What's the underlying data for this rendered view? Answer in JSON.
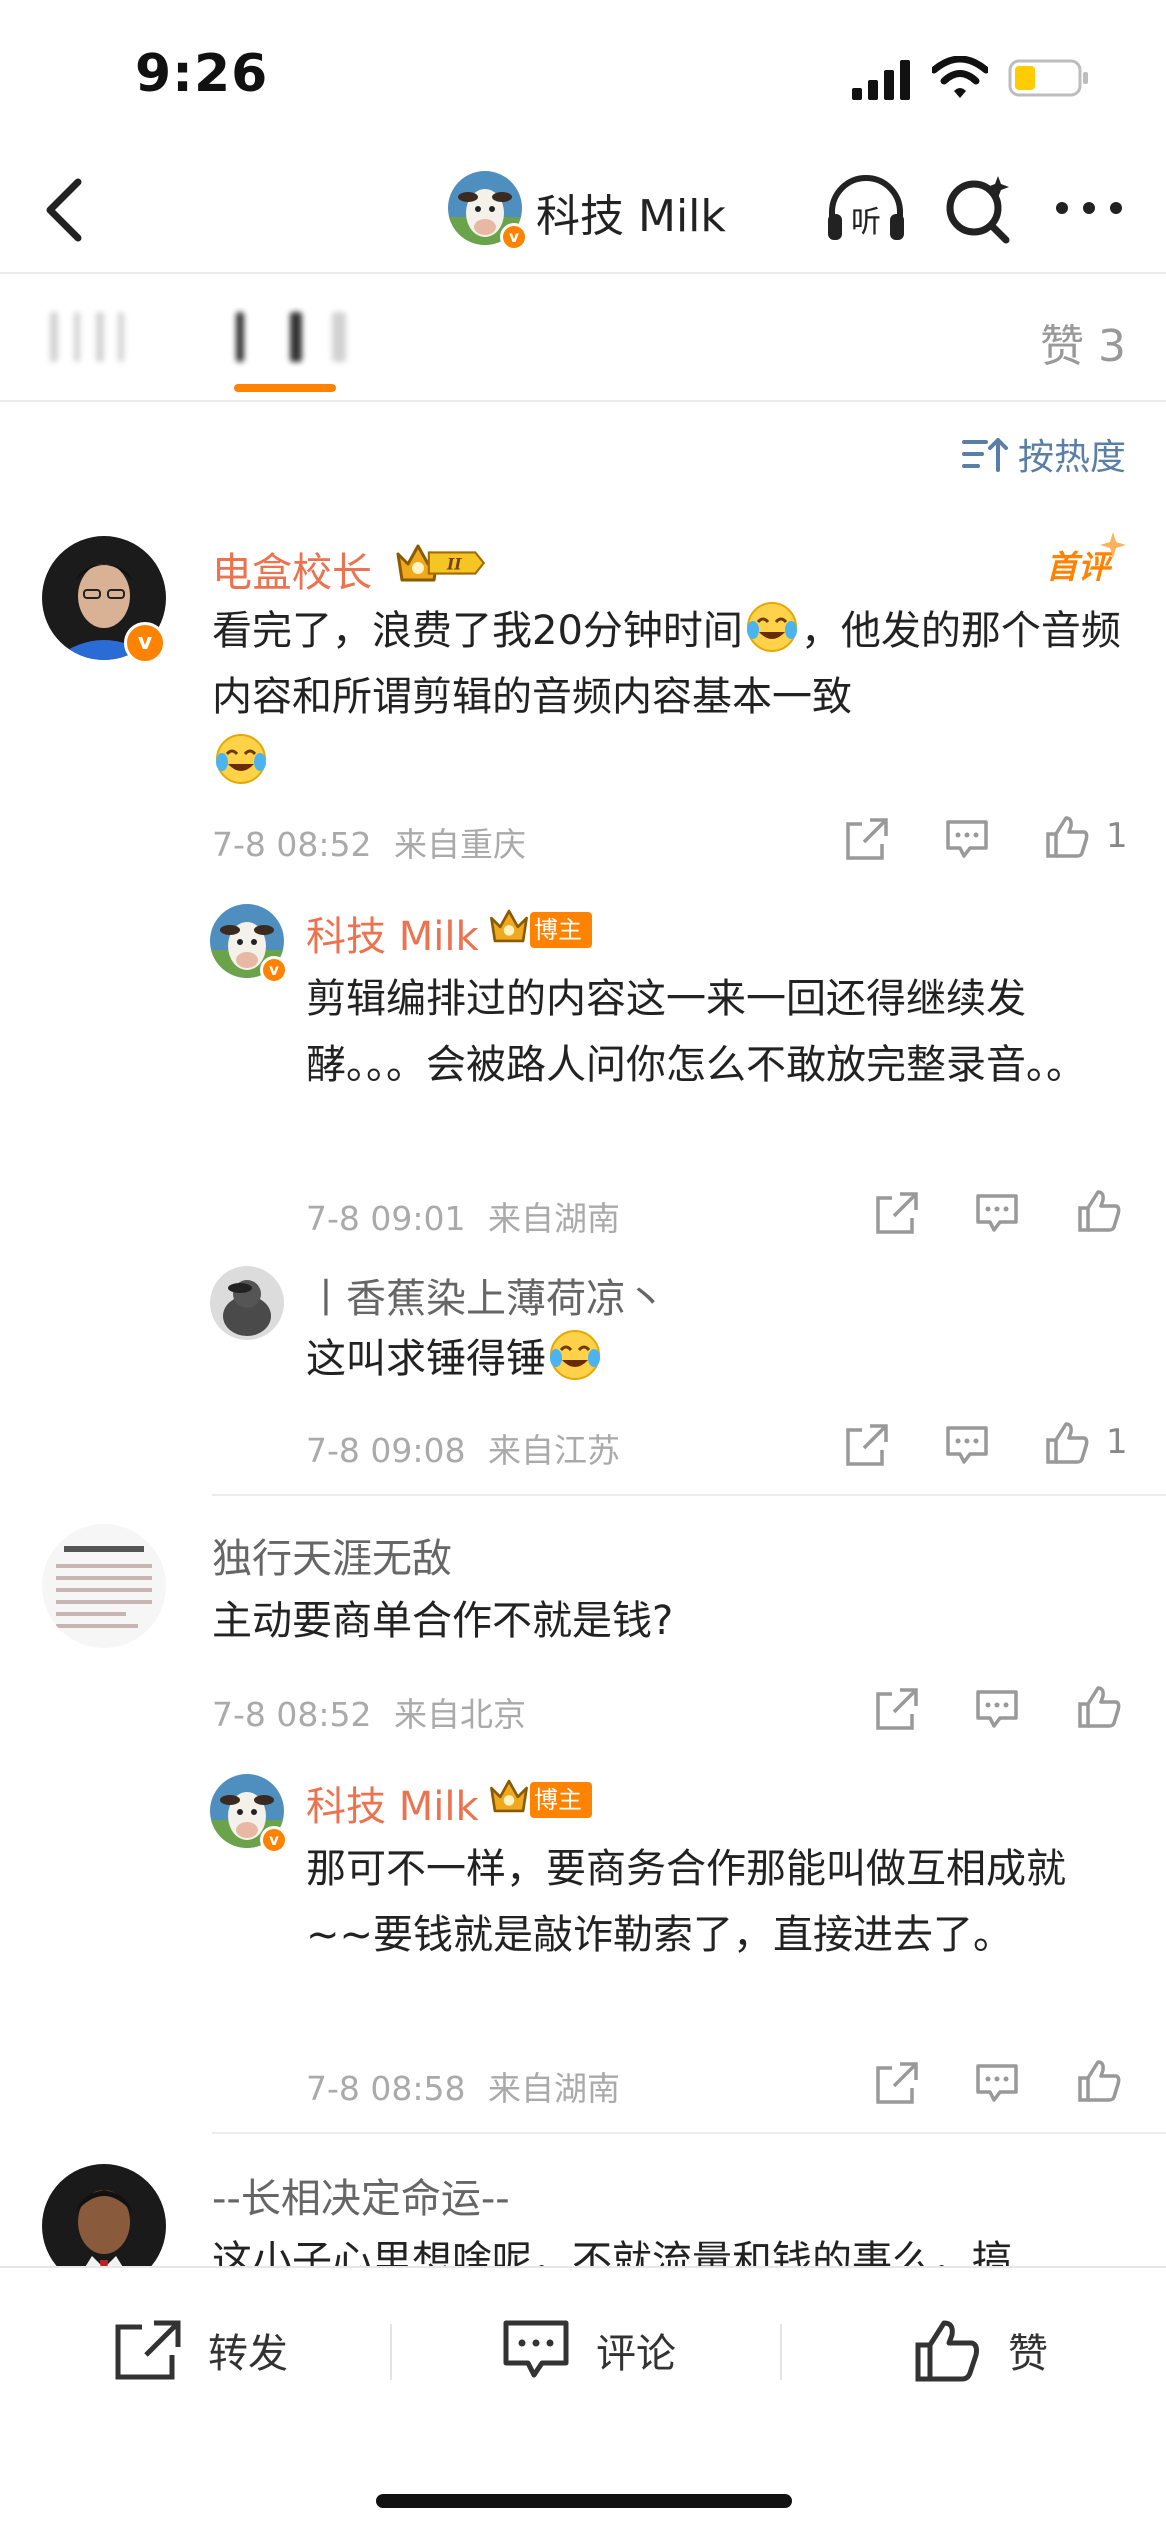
{
  "status_bar": {
    "time": "9:26"
  },
  "nav": {
    "title": "科技 Milk",
    "listen_glyph": "听"
  },
  "tabs": {
    "likes_label": "赞 3"
  },
  "sort": {
    "label": "按热度"
  },
  "comments": [
    {
      "user": "电盒校长",
      "level": "II",
      "first_tag": "首评",
      "text_a": "看完了，浪费了我20分钟时间",
      "text_b": "，他发的那个音频内容和所谓剪辑的音频内容基本一致",
      "time": "7-8 08:52",
      "location": "来自重庆",
      "likes": "1",
      "replies": [
        {
          "user": "科技 Milk",
          "tag": "博主",
          "text": "剪辑编排过的内容这一来一回还得继续发酵。。。会被路人问你怎么不敢放完整录音。。",
          "time": "7-8 09:01",
          "location": "来自湖南"
        },
        {
          "user": "丨香蕉染上薄荷凉丶",
          "text": "这叫求锤得锤",
          "time": "7-8 09:08",
          "location": "来自江苏",
          "likes": "1"
        }
      ]
    },
    {
      "user": "独行天涯无敌",
      "text": "主动要商单合作不就是钱?",
      "time": "7-8 08:52",
      "location": "来自北京",
      "replies": [
        {
          "user": "科技 Milk",
          "tag": "博主",
          "text": "那可不一样，要商务合作那能叫做互相成就 ~~要钱就是敲诈勒索了，直接进去了。",
          "time": "7-8 08:58",
          "location": "来自湖南"
        }
      ]
    },
    {
      "user": "--长相决定命运--",
      "text": "这小子心里想啥呢，不就流量和钱的事么，搞"
    }
  ],
  "bottom_bar": {
    "repost": "转发",
    "comment": "评论",
    "like": "赞"
  },
  "icons": {
    "back": "chevron-left-icon",
    "listen": "headphones-icon",
    "search": "search-icon",
    "more": "more-icon",
    "share": "share-icon",
    "comment": "comment-icon",
    "like": "thumbs-up-icon",
    "sort": "sort-icon",
    "emoji": "laughing-crying-emoji"
  },
  "colors": {
    "accent": "#ff8200",
    "username": "#eb7350",
    "sort_text": "#5a7fa6",
    "meta_text": "#aaaaaa"
  }
}
